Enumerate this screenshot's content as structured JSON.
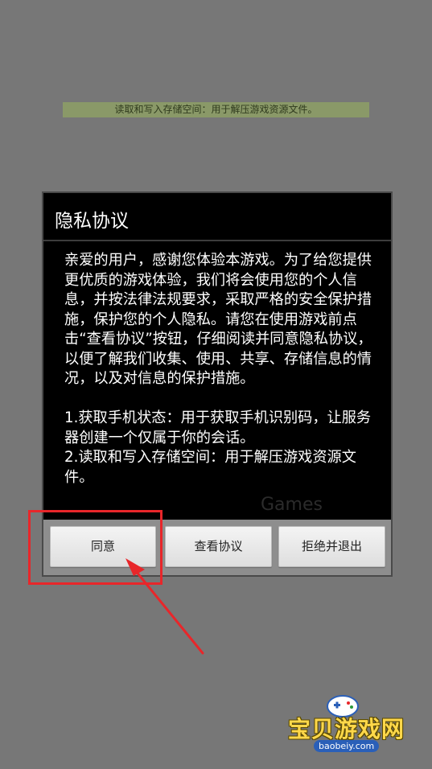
{
  "toast": {
    "text": "读取和写入存储空间：用于解压游戏资源文件。"
  },
  "dialog": {
    "title": "隐私协议",
    "body": "亲爱的用户，感谢您体验本游戏。为了给您提供更优质的游戏体验，我们将会使用您的个人信息，并按法律法规要求，采取严格的安全保护措施，保护您的个人隐私。请您在使用游戏前点击“查看协议”按钮，仔细阅读并同意隐私协议，以便了解我们收集、使用、共享、存储信息的情况，以及对信息的保护措施。\n\n1.获取手机状态：用于获取手机识别码，让服务器创建一个仅属于你的会话。\n2.读取和写入存储空间：用于解压游戏资源文件。",
    "background_text": "Games",
    "buttons": {
      "agree": "同意",
      "view": "查看协议",
      "reject": "拒绝并退出"
    }
  },
  "watermark": {
    "title": "宝贝游戏网",
    "url": "baobeiy.com"
  },
  "colors": {
    "overlay": "#777777",
    "dialog_bg": "#000000",
    "button_bar": "#8e8e8e",
    "highlight": "#e8262a",
    "watermark_text": "#ffd84a"
  }
}
